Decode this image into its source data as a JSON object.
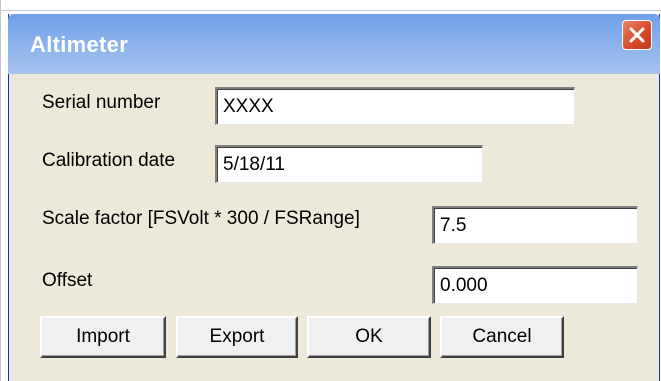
{
  "window": {
    "title": "Altimeter"
  },
  "fields": {
    "serial_number": {
      "label": "Serial number",
      "value": "XXXX"
    },
    "calibration_date": {
      "label": "Calibration date",
      "value": "5/18/11"
    },
    "scale_factor": {
      "label": "Scale factor [FSVolt * 300 / FSRange]",
      "value": "7.5"
    },
    "offset": {
      "label": "Offset",
      "value": "0.000"
    }
  },
  "buttons": {
    "import": "Import",
    "export": "Export",
    "ok": "OK",
    "cancel": "Cancel"
  },
  "colors": {
    "titlebar": "#7aa7ea",
    "dialog_bg": "#ece9d8",
    "close_button": "#d84a2a"
  }
}
